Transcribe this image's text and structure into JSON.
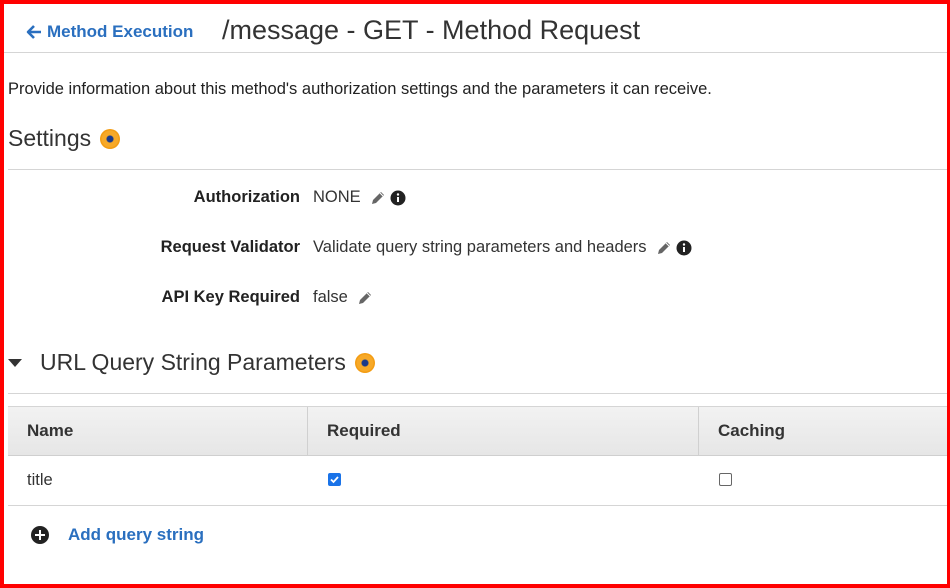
{
  "header": {
    "back_label": "Method Execution",
    "title": "/message - GET - Method Request"
  },
  "description": "Provide information about this method's authorization settings and the parameters it can receive.",
  "settings": {
    "heading": "Settings",
    "rows": [
      {
        "label": "Authorization",
        "value": "NONE"
      },
      {
        "label": "Request Validator",
        "value": "Validate query string parameters and headers"
      },
      {
        "label": "API Key Required",
        "value": "false"
      }
    ]
  },
  "query_params": {
    "heading": "URL Query String Parameters",
    "columns": [
      "Name",
      "Required",
      "Caching"
    ],
    "rows": [
      {
        "name": "title",
        "required": true,
        "caching": false
      }
    ],
    "add_label": "Add query string"
  },
  "colors": {
    "link": "#2a6fbf",
    "frame": "#ff0000",
    "checkbox_checked": "#1a73e8",
    "info_dot": "#f7a928"
  },
  "icons": [
    "arrow-left-icon",
    "info-dot-icon",
    "pencil-icon",
    "info-icon",
    "caret-down-icon",
    "plus-circle-icon",
    "checkbox"
  ]
}
